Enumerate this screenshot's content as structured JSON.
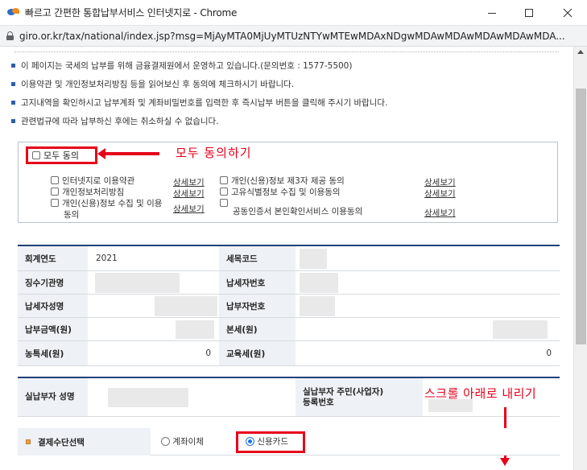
{
  "window": {
    "title": "빠르고 간편한 통합납부서비스 인터넷지로 - Chrome",
    "url": "giro.or.kr/tax/national/index.jsp?msg=MjAyMTA0MjUyMTUzNTYwMTEwMDAxNDgwMDAwMDAwMDAwMDAwMDA..."
  },
  "notices": [
    "이 페이지는 국세의 납부를 위해 금융결제원에서 운영하고 있습니다.(문의번호 : 1577-5500)",
    "이용약관 및 개인정보처리방침 등을 읽어보신 후 동의에 체크하시기 바랍니다.",
    "고지내역을 확인하시고 납부계좌 및 계좌비밀번호를 입력한 후 즉시납부 버튼을 클릭해 주시기 바랍니다.",
    "관련법규에 따라 납부하신 후에는 취소하실 수 없습니다."
  ],
  "agreement": {
    "all_label": "모두 동의",
    "annotation": "모두 동의하기",
    "detail_label": "상세보기",
    "terms": [
      "인터넷지로 이용약관",
      "개인정보처리방침",
      "개인(신용)정보 수집 및 이용",
      "동의",
      "개인(신용)정보 제3자 제공 동의",
      "고유식별정보 수집 및 이용동의",
      "공동인증서 본인확인서비스 이용동의"
    ]
  },
  "table": {
    "fiscal_year_label": "회계연도",
    "fiscal_year_value": "2021",
    "tax_code_label": "세목코드",
    "agency_label": "징수기관명",
    "taxpayer_no_label": "납세자번호",
    "taxpayer_name_label": "납세자성명",
    "payment_no_label": "납부자번호",
    "amount_label": "납부금액(원)",
    "main_tax_label": "본세(원)",
    "rural_tax_label": "농특세(원)",
    "rural_tax_value": "0",
    "edu_tax_label": "교육세(원)",
    "edu_tax_value": "0"
  },
  "payer": {
    "name_label": "실납부자 성명",
    "id_label_1": "실납부자 주민(사업자)",
    "id_label_2": "등록번호",
    "annotation": "스크롤 아래로 내리기"
  },
  "payment": {
    "label": "결제수단선택",
    "option_transfer": "계좌이체",
    "option_card": "신용카드",
    "selected": "신용카드"
  },
  "colors": {
    "annotation_red": "#e6001a",
    "table_border_navy": "#20407a",
    "label_bg": "#eef1f5"
  }
}
